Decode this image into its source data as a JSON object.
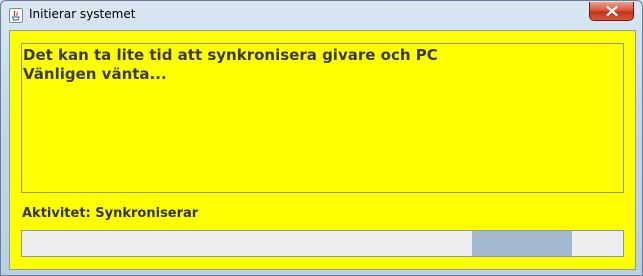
{
  "window": {
    "title": "Initierar systemet",
    "icon": "java-icon",
    "close_icon": "close-icon"
  },
  "message": {
    "lines": [
      "Det kan ta lite tid att synkronisera givare och PC",
      "Vänligen vänta..."
    ]
  },
  "status": {
    "activity_label": "Aktivitet: Synkroniserar"
  },
  "progress": {
    "mode": "indeterminate"
  },
  "colors": {
    "background": "#ffff00",
    "progress_track": "#eeeeee",
    "progress_fill": "#a2b8cf",
    "close_button": "#c4331a"
  }
}
